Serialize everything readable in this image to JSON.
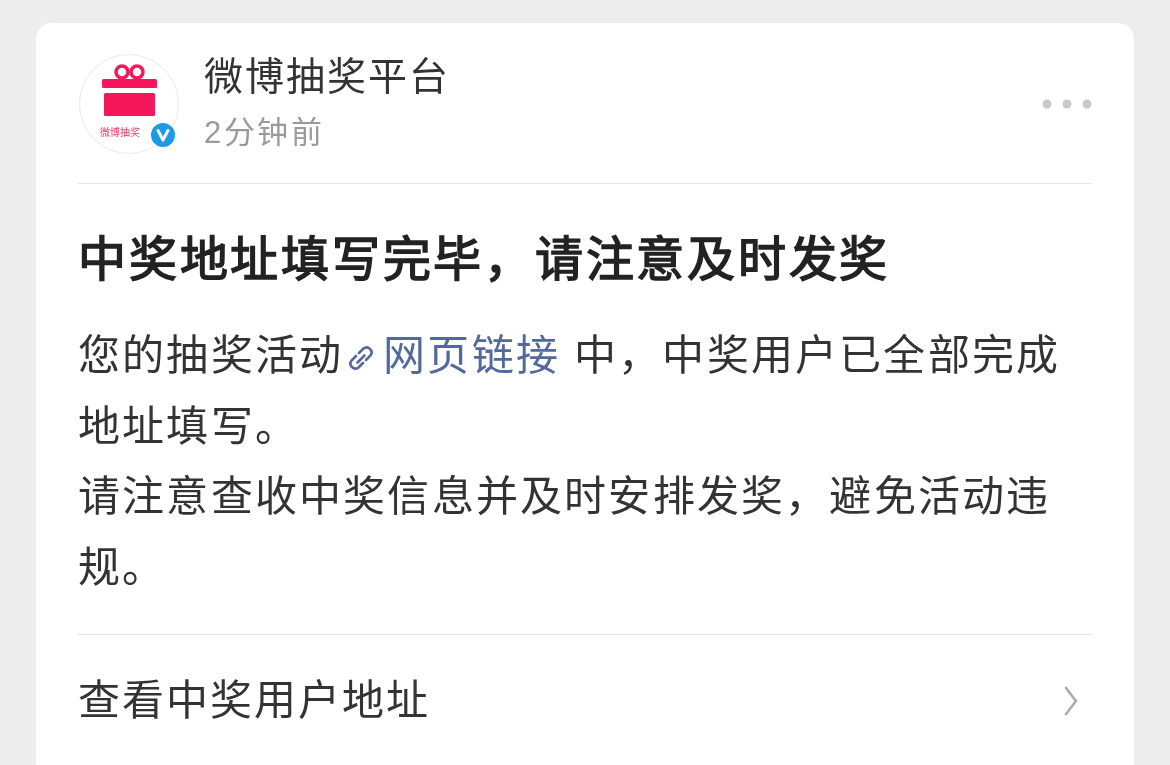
{
  "post": {
    "author": {
      "name": "微博抽奖平台",
      "avatar_caption": "微博抽奖",
      "verified": true
    },
    "time": "2分钟前"
  },
  "message": {
    "title": "中奖地址填写完毕，请注意及时发奖",
    "paragraphs": [
      {
        "segments": [
          {
            "kind": "text",
            "text": "您的抽奖活动"
          },
          {
            "kind": "link",
            "text": "网页链接"
          },
          {
            "kind": "text",
            "text": "中，中奖用户已全部完成地址填写。"
          }
        ]
      },
      {
        "segments": [
          {
            "kind": "text",
            "text": "请注意查收中奖信息并及时安排发奖，避免活动违规。"
          }
        ]
      }
    ]
  },
  "footer": {
    "action": "查看中奖用户地址"
  }
}
